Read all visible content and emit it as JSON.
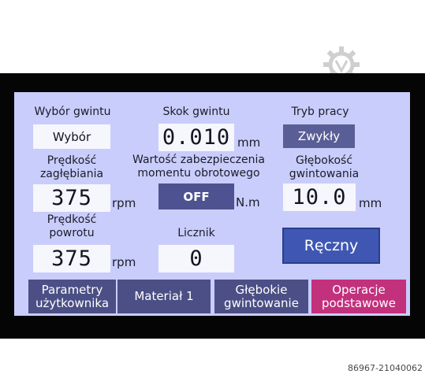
{
  "settings": {
    "thread_selection": {
      "label": "Wybór gwintu",
      "value": "Wybór"
    },
    "thread_pitch": {
      "label": "Skok gwintu",
      "value": "0.010",
      "unit": "mm"
    },
    "work_mode": {
      "label": "Tryb pracy",
      "value": "Zwykły"
    },
    "plunge_speed": {
      "label_line1": "Prędkość",
      "label_line2": "zagłębiania",
      "value": "375",
      "unit": "rpm"
    },
    "torque_protection": {
      "label_line1": "Wartość zabezpieczenia",
      "label_line2": "momentu obrotowego",
      "value": "OFF",
      "unit": "N.m"
    },
    "tapping_depth": {
      "label_line1": "Głębokość",
      "label_line2": "gwintowania",
      "value": "10.0",
      "unit": "mm"
    },
    "return_speed": {
      "label_line1": "Prędkość",
      "label_line2": "powrotu",
      "value": "375",
      "unit": "rpm"
    },
    "counter": {
      "label": "Licznik",
      "value": "0"
    },
    "manual_button": "Ręczny"
  },
  "nav": {
    "user_params": {
      "line1": "Parametry",
      "line2": "użytkownika"
    },
    "material": {
      "line1": "Materiał 1"
    },
    "deep_tapping": {
      "line1": "Głębokie",
      "line2": "gwintowanie"
    },
    "basic_ops": {
      "line1": "Operacje",
      "line2": "podstawowe"
    }
  },
  "watermark": {
    "id": "86967-21040062"
  },
  "colors": {
    "screen_bg": "#c9cdfb",
    "field_bg": "#f6f6fd",
    "dark_button": "#4e5290",
    "manual_button": "#3f57b3",
    "nav_button": "#4b4f85",
    "nav_active": "#c2317c"
  }
}
